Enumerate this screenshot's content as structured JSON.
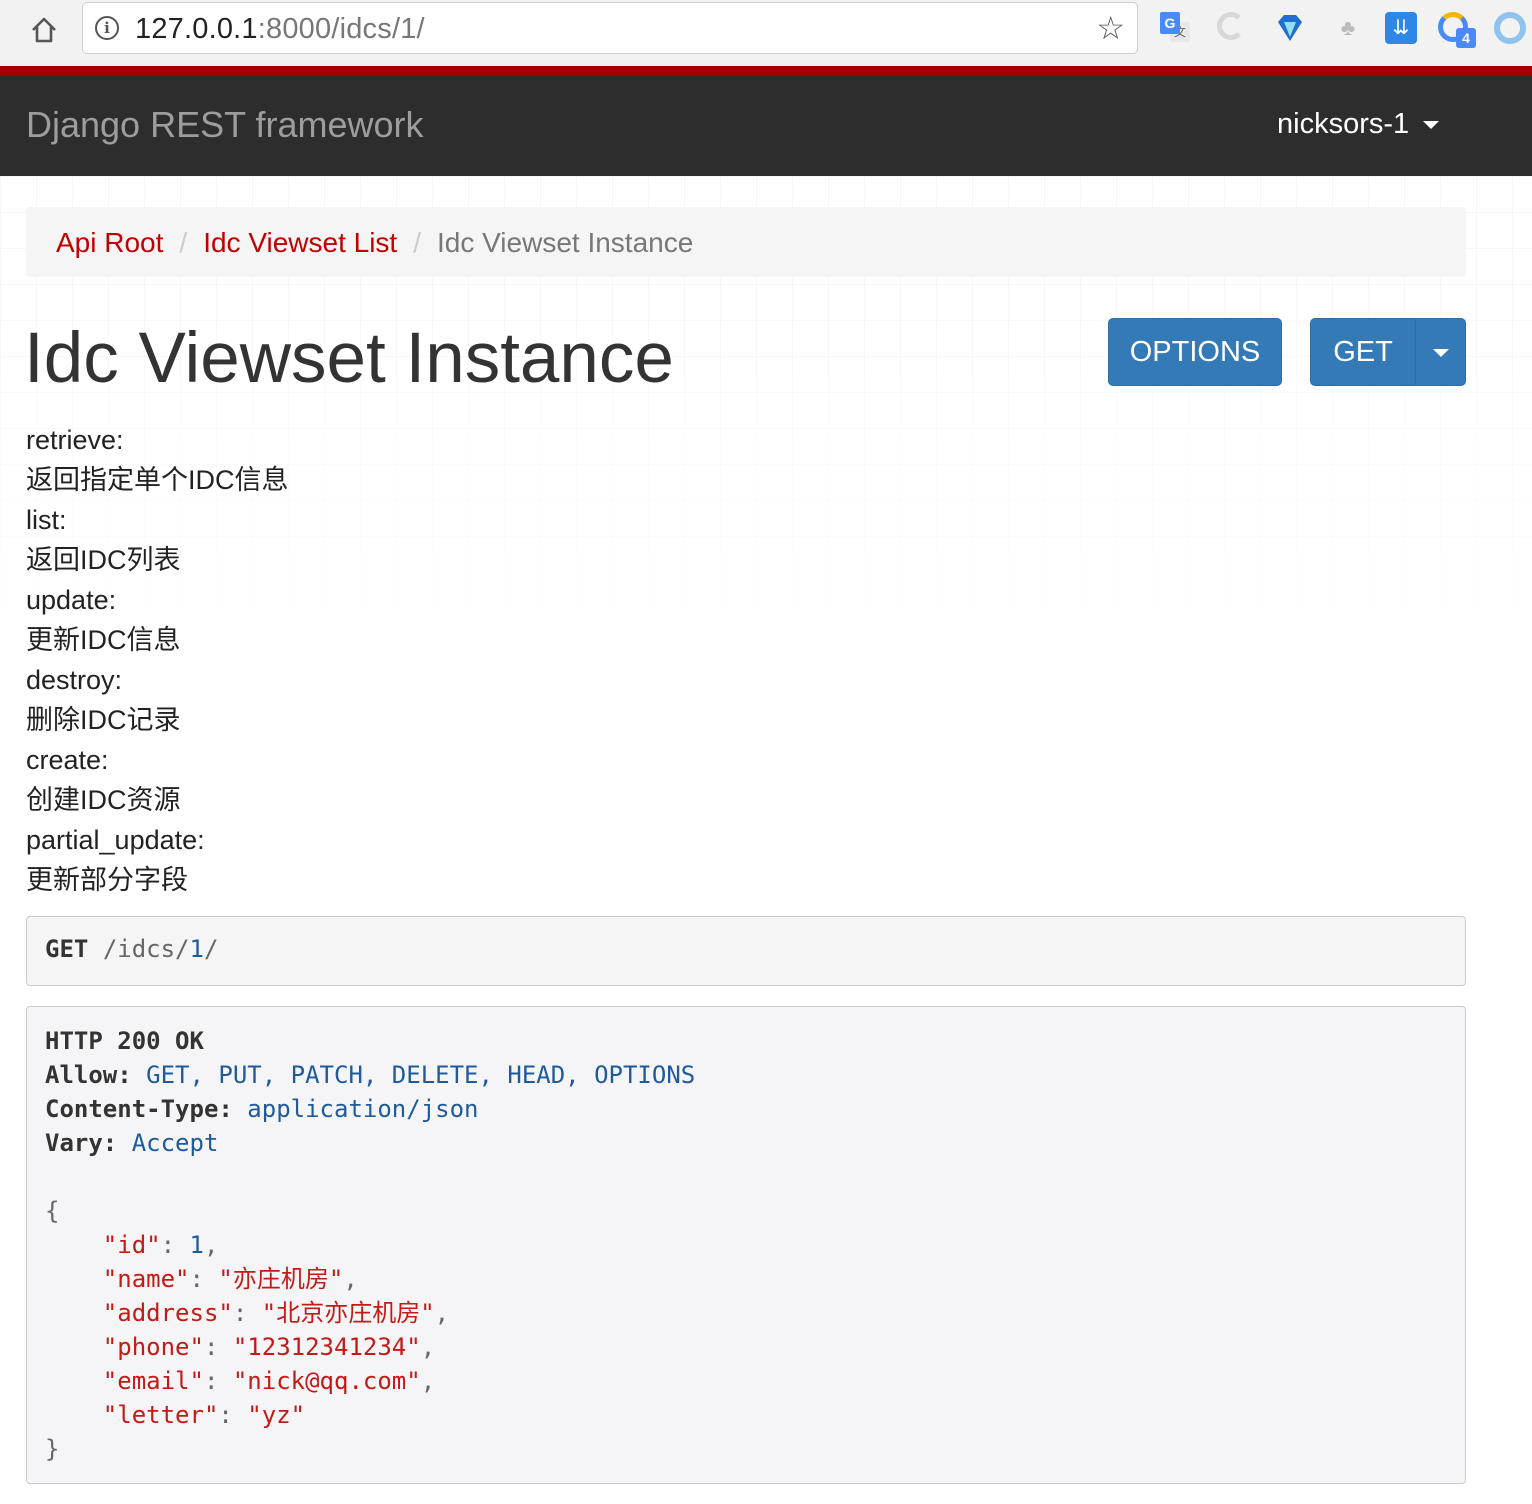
{
  "browser": {
    "url_host": "127.0.0.1",
    "url_rest": ":8000/idcs/1/"
  },
  "navbar": {
    "brand": "Django REST framework",
    "user": "nicksors-1"
  },
  "breadcrumb": {
    "items": [
      "Api Root",
      "Idc Viewset List"
    ],
    "active": "Idc Viewset Instance",
    "separator": "/"
  },
  "page": {
    "title": "Idc Viewset Instance",
    "buttons": {
      "options": "OPTIONS",
      "get": "GET"
    }
  },
  "description": [
    "retrieve:",
    "返回指定单个IDC信息",
    "list:",
    "返回IDC列表",
    "update:",
    "更新IDC信息",
    "destroy:",
    "删除IDC记录",
    "create:",
    "创建IDC资源",
    "partial_update:",
    "更新部分字段"
  ],
  "request": {
    "method": "GET",
    "path_prefix": "/idcs/",
    "path_id": "1",
    "path_suffix": "/"
  },
  "response": {
    "status": "HTTP 200 OK",
    "headers": [
      {
        "key": "Allow:",
        "value": "GET, PUT, PATCH, DELETE, HEAD, OPTIONS"
      },
      {
        "key": "Content-Type:",
        "value": "application/json"
      },
      {
        "key": "Vary:",
        "value": "Accept"
      }
    ],
    "json_open": "{",
    "json_close": "}",
    "body": [
      {
        "key": "\"id\"",
        "value": "1",
        "type": "number",
        "comma": ","
      },
      {
        "key": "\"name\"",
        "value": "\"亦庄机房\"",
        "type": "string",
        "comma": ","
      },
      {
        "key": "\"address\"",
        "value": "\"北京亦庄机房\"",
        "type": "string",
        "comma": ","
      },
      {
        "key": "\"phone\"",
        "value": "\"12312341234\"",
        "type": "string",
        "comma": ","
      },
      {
        "key": "\"email\"",
        "value": "\"nick@qq.com\"",
        "type": "string",
        "comma": ","
      },
      {
        "key": "\"letter\"",
        "value": "\"yz\"",
        "type": "string",
        "comma": ""
      }
    ]
  },
  "icons": {
    "home": "home-icon",
    "info": "info-icon",
    "star": "star-icon",
    "info_glyph": "i",
    "star_glyph": "☆",
    "ext_translate_a": "G",
    "ext_translate_b": "文",
    "ext_tree": "♣",
    "ext_down": "⇊",
    "ext_cal_badge": "4"
  },
  "colors": {
    "accent_red": "#a30000",
    "navbar_bg": "#2d2d2d",
    "button_blue": "#337ab7",
    "link_red": "#c20000",
    "json_string": "#c41a16",
    "json_value_blue": "#1e5a9c"
  }
}
